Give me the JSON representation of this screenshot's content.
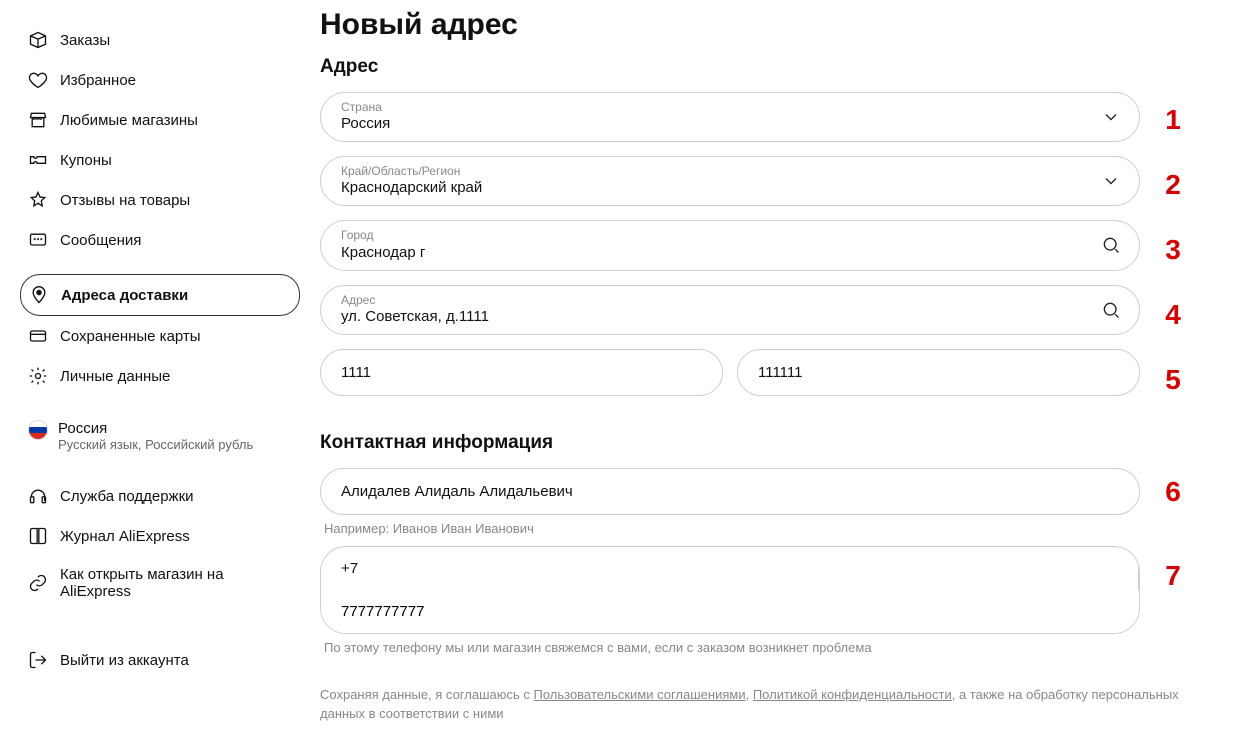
{
  "sidebar": {
    "items": [
      {
        "label": "Заказы"
      },
      {
        "label": "Избранное"
      },
      {
        "label": "Любимые магазины"
      },
      {
        "label": "Купоны"
      },
      {
        "label": "Отзывы на товары"
      },
      {
        "label": "Сообщения"
      },
      {
        "label": "Адреса доставки"
      },
      {
        "label": "Сохраненные карты"
      },
      {
        "label": "Личные данные"
      }
    ],
    "locale": {
      "country": "Россия",
      "detail": "Русский язык, Российский рубль"
    },
    "support": [
      {
        "label": "Служба поддержки"
      },
      {
        "label": "Журнал AliExpress"
      },
      {
        "label": "Как открыть магазин на AliExpress"
      }
    ],
    "logout": "Выйти из аккаунта"
  },
  "main": {
    "title": "Новый адрес",
    "section_address": "Адрес",
    "section_contact": "Контактная информация",
    "fields": {
      "country_label": "Страна",
      "country_value": "Россия",
      "region_label": "Край/Область/Регион",
      "region_value": "Краснодарский край",
      "city_label": "Город",
      "city_value": "Краснодар г",
      "address_label": "Адрес",
      "address_value": "ул. Советская, д.1111",
      "apt_value": "1111",
      "postal_value": "111111",
      "fullname_value": "Алидалев Алидаль Алидальевич",
      "fullname_hint": "Например: Иванов Иван Иванович",
      "phone_cc": "+7",
      "phone_value": "7777777777",
      "phone_hint": "По этому телефону мы или магазин свяжемся с вами, если с заказом возникнет проблема"
    },
    "annotations": [
      "1",
      "2",
      "3",
      "4",
      "5",
      "6",
      "7"
    ],
    "disclaimer": {
      "p1": "Сохраняя данные, я соглашаюсь с ",
      "link1": "Пользовательскими соглашениями",
      "sep": ", ",
      "link2": "Политикой конфиденциальности",
      "p2": ", а также на обработку персональных данных в соответствии с ними"
    }
  }
}
